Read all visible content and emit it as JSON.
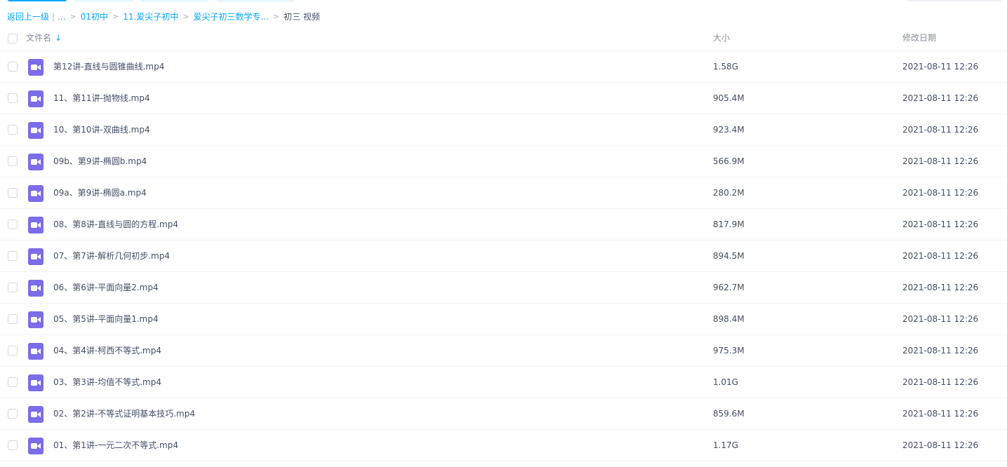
{
  "breadcrumb": {
    "back_label": "返回上一级",
    "pipe": "|",
    "ellipsis": "...",
    "separator": ">",
    "crumbs": [
      "01初中",
      "11.爱尖子初中",
      "爱尖子初三数学专..."
    ],
    "current": "初三 视频"
  },
  "table": {
    "headers": {
      "name": "文件名",
      "sort_indicator": "↓",
      "size": "大小",
      "modified": "修改日期"
    },
    "icon": "video-file-icon",
    "icon_color": "#7b6ce9",
    "rows": [
      {
        "name": "第12讲-直线与圆锥曲线.mp4",
        "size": "1.58G",
        "modified": "2021-08-11 12:26"
      },
      {
        "name": "11、第11讲-抛物线.mp4",
        "size": "905.4M",
        "modified": "2021-08-11 12:26"
      },
      {
        "name": "10、第10讲-双曲线.mp4",
        "size": "923.4M",
        "modified": "2021-08-11 12:26"
      },
      {
        "name": "09b、第9讲-椭圆b.mp4",
        "size": "566.9M",
        "modified": "2021-08-11 12:26"
      },
      {
        "name": "09a、第9讲-椭圆a.mp4",
        "size": "280.2M",
        "modified": "2021-08-11 12:26"
      },
      {
        "name": "08、第8讲-直线与圆的方程.mp4",
        "size": "817.9M",
        "modified": "2021-08-11 12:26"
      },
      {
        "name": "07、第7讲-解析几何初步.mp4",
        "size": "894.5M",
        "modified": "2021-08-11 12:26"
      },
      {
        "name": "06、第6讲-平面向量2.mp4",
        "size": "962.7M",
        "modified": "2021-08-11 12:26"
      },
      {
        "name": "05、第5讲-平面向量1.mp4",
        "size": "898.4M",
        "modified": "2021-08-11 12:26"
      },
      {
        "name": "04、第4讲-柯西不等式.mp4",
        "size": "975.3M",
        "modified": "2021-08-11 12:26"
      },
      {
        "name": "03、第3讲-均值不等式.mp4",
        "size": "1.01G",
        "modified": "2021-08-11 12:26"
      },
      {
        "name": "02、第2讲-不等式证明基本技巧.mp4",
        "size": "859.6M",
        "modified": "2021-08-11 12:26"
      },
      {
        "name": "01、第1讲-一元二次不等式.mp4",
        "size": "1.17G",
        "modified": "2021-08-11 12:26"
      }
    ]
  },
  "colors": {
    "accent": "#06a7ff",
    "text": "#424e67",
    "muted": "#878c9c"
  }
}
